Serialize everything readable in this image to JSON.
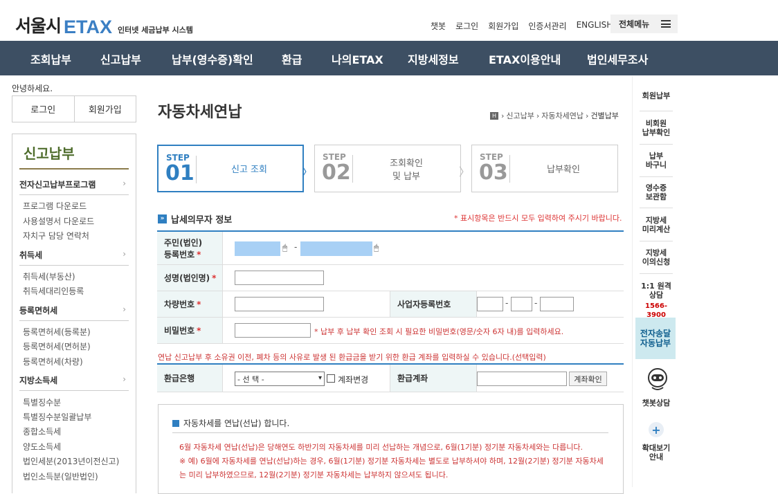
{
  "header": {
    "logo_city": "서울시",
    "logo_etax": "ETAX",
    "logo_sub": "인터넷 세금납부 시스템",
    "links": [
      "챗봇",
      "로그인",
      "회원가입",
      "인증서관리",
      "ENGLISH"
    ],
    "all_menu": "전체메뉴"
  },
  "gnb": [
    "조회납부",
    "신고납부",
    "납부(영수증)확인",
    "환급",
    "나의ETAX",
    "지방세정보",
    "ETAX이용안내",
    "법인세무조사"
  ],
  "left": {
    "greeting": "안녕하세요.",
    "login": "로그인",
    "join": "회원가입",
    "title": "신고납부",
    "categories": [
      {
        "label": "전자신고납부프로그램",
        "subs": [
          "프로그램 다운로드",
          "사용설명서 다운로드",
          "자치구 담당 연락처"
        ]
      },
      {
        "label": "취득세",
        "subs": [
          "취득세(부동산)",
          "취득세대리인등록"
        ]
      },
      {
        "label": "등록면허세",
        "subs": [
          "등록면허세(등록분)",
          "등록면허세(면허분)",
          "등록면허세(차량)"
        ]
      },
      {
        "label": "지방소득세",
        "subs": [
          "특별징수분",
          "특별징수분일괄납부",
          "종합소득세",
          "양도소득세",
          "법인세분(2013년이전신고)",
          "법인소득분(일반법인)"
        ]
      }
    ],
    "arrow": "›"
  },
  "main": {
    "title": "자동차세연납",
    "breadcrumb": {
      "home": "H",
      "items": [
        "신고납부",
        "자동차세연납",
        "건별납부"
      ],
      "sep": "›"
    },
    "steps": [
      {
        "lbl": "STEP",
        "num": "01",
        "text": "신고 조회"
      },
      {
        "lbl": "STEP",
        "num": "02",
        "text": "조회확인\n및 납부"
      },
      {
        "lbl": "STEP",
        "num": "03",
        "text": "납부확인"
      }
    ],
    "step_arrow": "〉",
    "section_title": "납세의무자 정보",
    "section_icon": "»",
    "required_note": "* 표시항목은 반드시 모두 입력하여 주시기 바랍니다.",
    "fields": {
      "rrn_label1": "주민(법인)",
      "rrn_label2": "등록번호",
      "name_label": "성명(법인명)",
      "car_label": "차량번호",
      "biz_label": "사업자등록번호",
      "pw_label": "비밀번호",
      "pw_hint": "* 납부 후 납부 확인 조회 시 필요한 비밀번호(영문/숫자 6자 내)를 입력하세요.",
      "dash": "-",
      "star": "*",
      "mouse": "🖱"
    },
    "refund_note": "연납 신고납부 후 소유권 이전, 폐차 등의 사유로 발생 된 환급금을 받기 위한 환급 계좌를 입력하실 수 있습니다.(선택입력)",
    "refund": {
      "bank_label": "환급은행",
      "select_value": "- 선 택 -",
      "dd": "▾",
      "change_label": "계좌변경",
      "account_label": "환급계좌",
      "check_button": "계좌확인"
    },
    "info": {
      "head": "자동차세를 연납(선납) 합니다.",
      "lines": [
        "6월 자동차세 연납(선납)은 당해연도 하반기의 자동차세를 미리 선납하는 개념으로, 6월(1기분) 정기분 자동차세와는 다릅니다.",
        "※ 예) 6월에 자동차세를 연납(선납)하는 경우, 6월(1기분) 정기분 자동차세는 별도로 납부하셔야 하며, 12월(2기분) 정기분 자동차세",
        "는 미리 납부하였으므로, 12월(2기분) 정기분 자동차세는 납부하지 않으셔도 됩니다."
      ]
    }
  },
  "right": {
    "items": [
      "회원납부",
      "비회원\n납부확인",
      "납부\n바구니",
      "영수증\n보관함",
      "지방세\n미리계산",
      "지방세\n이의신청",
      "1:1 원격\n상담"
    ],
    "phone": "1566-3900",
    "electronic": "전자송달\n자동납부",
    "chatbot": "챗봇상담",
    "zoom": "확대보기\n안내",
    "plus": "+"
  },
  "colors": {
    "gnb": "#3d4f63",
    "accent": "#2f7fc1",
    "required": "#dd3333"
  }
}
